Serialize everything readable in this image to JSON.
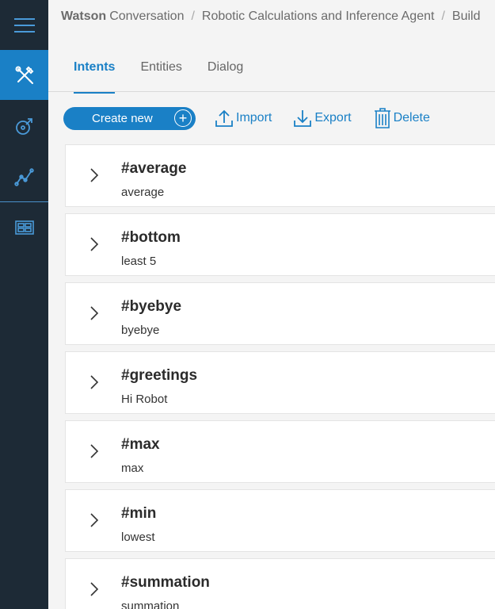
{
  "breadcrumb": {
    "brand": "Watson",
    "brand_rest": "Conversation",
    "sep1": "/",
    "workspace": "Robotic Calculations and Inference Agent",
    "sep2": "/",
    "section": "Build"
  },
  "tabs": [
    {
      "label": "Intents",
      "active": true
    },
    {
      "label": "Entities",
      "active": false
    },
    {
      "label": "Dialog",
      "active": false
    }
  ],
  "toolbar": {
    "create_label": "Create new",
    "import_label": "Import",
    "export_label": "Export",
    "delete_label": "Delete"
  },
  "intents": [
    {
      "name": "#average",
      "example": "average"
    },
    {
      "name": "#bottom",
      "example": "least 5"
    },
    {
      "name": "#byebye",
      "example": "byebye"
    },
    {
      "name": "#greetings",
      "example": "Hi Robot"
    },
    {
      "name": "#max",
      "example": "max"
    },
    {
      "name": "#min",
      "example": "lowest"
    },
    {
      "name": "#summation",
      "example": "summation"
    }
  ],
  "colors": {
    "accent": "#1a80c6",
    "sidebar": "#1d2a36",
    "background": "#f4f4f4"
  },
  "icons": {
    "menu": "hamburger-menu-icon",
    "build": "tools-icon",
    "improve": "improve-icon",
    "analytics": "analytics-icon",
    "workspace": "workspace-grid-icon"
  }
}
